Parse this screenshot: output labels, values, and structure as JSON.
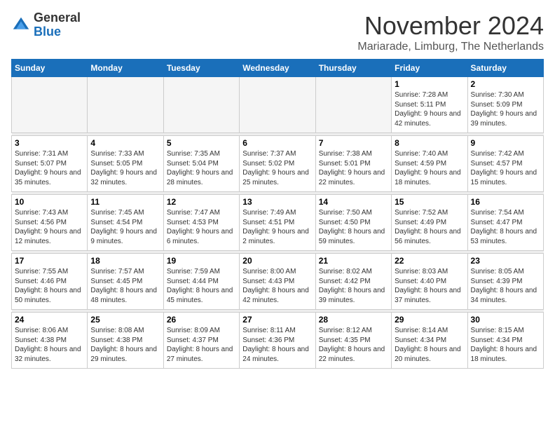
{
  "logo": {
    "general": "General",
    "blue": "Blue"
  },
  "title": "November 2024",
  "location": "Mariarade, Limburg, The Netherlands",
  "headers": [
    "Sunday",
    "Monday",
    "Tuesday",
    "Wednesday",
    "Thursday",
    "Friday",
    "Saturday"
  ],
  "weeks": [
    [
      {
        "day": "",
        "info": ""
      },
      {
        "day": "",
        "info": ""
      },
      {
        "day": "",
        "info": ""
      },
      {
        "day": "",
        "info": ""
      },
      {
        "day": "",
        "info": ""
      },
      {
        "day": "1",
        "info": "Sunrise: 7:28 AM\nSunset: 5:11 PM\nDaylight: 9 hours and 42 minutes."
      },
      {
        "day": "2",
        "info": "Sunrise: 7:30 AM\nSunset: 5:09 PM\nDaylight: 9 hours and 39 minutes."
      }
    ],
    [
      {
        "day": "3",
        "info": "Sunrise: 7:31 AM\nSunset: 5:07 PM\nDaylight: 9 hours and 35 minutes."
      },
      {
        "day": "4",
        "info": "Sunrise: 7:33 AM\nSunset: 5:05 PM\nDaylight: 9 hours and 32 minutes."
      },
      {
        "day": "5",
        "info": "Sunrise: 7:35 AM\nSunset: 5:04 PM\nDaylight: 9 hours and 28 minutes."
      },
      {
        "day": "6",
        "info": "Sunrise: 7:37 AM\nSunset: 5:02 PM\nDaylight: 9 hours and 25 minutes."
      },
      {
        "day": "7",
        "info": "Sunrise: 7:38 AM\nSunset: 5:01 PM\nDaylight: 9 hours and 22 minutes."
      },
      {
        "day": "8",
        "info": "Sunrise: 7:40 AM\nSunset: 4:59 PM\nDaylight: 9 hours and 18 minutes."
      },
      {
        "day": "9",
        "info": "Sunrise: 7:42 AM\nSunset: 4:57 PM\nDaylight: 9 hours and 15 minutes."
      }
    ],
    [
      {
        "day": "10",
        "info": "Sunrise: 7:43 AM\nSunset: 4:56 PM\nDaylight: 9 hours and 12 minutes."
      },
      {
        "day": "11",
        "info": "Sunrise: 7:45 AM\nSunset: 4:54 PM\nDaylight: 9 hours and 9 minutes."
      },
      {
        "day": "12",
        "info": "Sunrise: 7:47 AM\nSunset: 4:53 PM\nDaylight: 9 hours and 6 minutes."
      },
      {
        "day": "13",
        "info": "Sunrise: 7:49 AM\nSunset: 4:51 PM\nDaylight: 9 hours and 2 minutes."
      },
      {
        "day": "14",
        "info": "Sunrise: 7:50 AM\nSunset: 4:50 PM\nDaylight: 8 hours and 59 minutes."
      },
      {
        "day": "15",
        "info": "Sunrise: 7:52 AM\nSunset: 4:49 PM\nDaylight: 8 hours and 56 minutes."
      },
      {
        "day": "16",
        "info": "Sunrise: 7:54 AM\nSunset: 4:47 PM\nDaylight: 8 hours and 53 minutes."
      }
    ],
    [
      {
        "day": "17",
        "info": "Sunrise: 7:55 AM\nSunset: 4:46 PM\nDaylight: 8 hours and 50 minutes."
      },
      {
        "day": "18",
        "info": "Sunrise: 7:57 AM\nSunset: 4:45 PM\nDaylight: 8 hours and 48 minutes."
      },
      {
        "day": "19",
        "info": "Sunrise: 7:59 AM\nSunset: 4:44 PM\nDaylight: 8 hours and 45 minutes."
      },
      {
        "day": "20",
        "info": "Sunrise: 8:00 AM\nSunset: 4:43 PM\nDaylight: 8 hours and 42 minutes."
      },
      {
        "day": "21",
        "info": "Sunrise: 8:02 AM\nSunset: 4:42 PM\nDaylight: 8 hours and 39 minutes."
      },
      {
        "day": "22",
        "info": "Sunrise: 8:03 AM\nSunset: 4:40 PM\nDaylight: 8 hours and 37 minutes."
      },
      {
        "day": "23",
        "info": "Sunrise: 8:05 AM\nSunset: 4:39 PM\nDaylight: 8 hours and 34 minutes."
      }
    ],
    [
      {
        "day": "24",
        "info": "Sunrise: 8:06 AM\nSunset: 4:38 PM\nDaylight: 8 hours and 32 minutes."
      },
      {
        "day": "25",
        "info": "Sunrise: 8:08 AM\nSunset: 4:38 PM\nDaylight: 8 hours and 29 minutes."
      },
      {
        "day": "26",
        "info": "Sunrise: 8:09 AM\nSunset: 4:37 PM\nDaylight: 8 hours and 27 minutes."
      },
      {
        "day": "27",
        "info": "Sunrise: 8:11 AM\nSunset: 4:36 PM\nDaylight: 8 hours and 24 minutes."
      },
      {
        "day": "28",
        "info": "Sunrise: 8:12 AM\nSunset: 4:35 PM\nDaylight: 8 hours and 22 minutes."
      },
      {
        "day": "29",
        "info": "Sunrise: 8:14 AM\nSunset: 4:34 PM\nDaylight: 8 hours and 20 minutes."
      },
      {
        "day": "30",
        "info": "Sunrise: 8:15 AM\nSunset: 4:34 PM\nDaylight: 8 hours and 18 minutes."
      }
    ]
  ]
}
